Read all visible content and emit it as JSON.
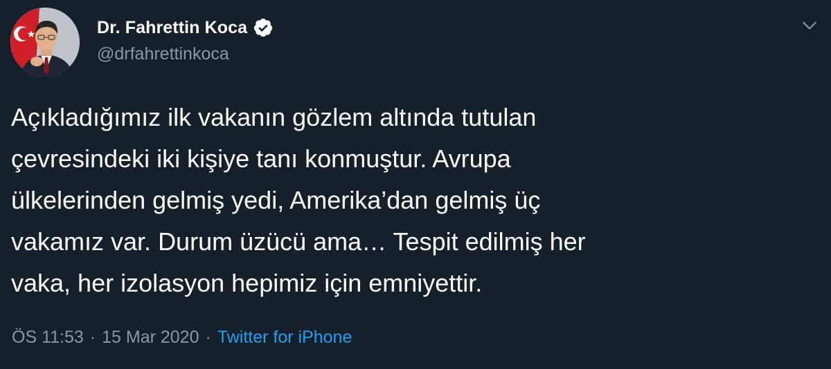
{
  "tweet": {
    "author": {
      "display_name": "Dr. Fahrettin Koca",
      "handle": "@drfahrettinkoca",
      "verified": true
    },
    "text": "Açıkladığımız ilk vakanın gözlem altında tutulan\nçevresindeki iki kişiye tanı konmuştur. Avrupa\nülkelerinden gelmiş yedi, Amerika’dan gelmiş üç\nvakamız var. Durum üzücü ama… Tespit edilmiş her\nvaka, her izolasyon hepimiz için emniyettir.",
    "time": "ÖS 11:53",
    "separator": "·",
    "date": "15 Mar 2020",
    "source": "Twitter for iPhone"
  },
  "icons": {
    "verified": "verified-badge-icon",
    "menu": "chevron-down-icon"
  },
  "colors": {
    "background": "#15202b",
    "text": "#ffffff",
    "secondary_text": "#8899a6",
    "link": "#1da1f2"
  }
}
